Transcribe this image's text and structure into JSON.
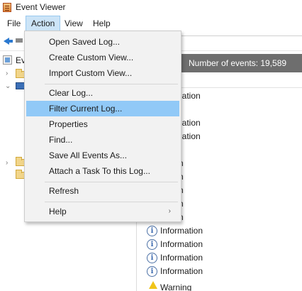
{
  "window": {
    "title": "Event Viewer"
  },
  "menubar": {
    "items": [
      {
        "label": "File"
      },
      {
        "label": "Action"
      },
      {
        "label": "View"
      },
      {
        "label": "Help"
      }
    ]
  },
  "tree": {
    "root_label": "Ev"
  },
  "content": {
    "header_count": "Number of events: 19,589",
    "rows": [
      {
        "level": "nformation"
      },
      {
        "level": "ng"
      },
      {
        "level": "nformation"
      },
      {
        "level": "nformation"
      },
      {
        "level": "ng"
      },
      {
        "level": "nation"
      },
      {
        "level": "nation"
      },
      {
        "level": "nation"
      },
      {
        "level": "nation"
      },
      {
        "level": "nation"
      },
      {
        "level": "Information"
      },
      {
        "level": "Information"
      },
      {
        "level": "Information"
      },
      {
        "level": "Information"
      },
      {
        "level": "Warning"
      }
    ]
  },
  "action_menu": {
    "items": [
      {
        "label": "Open Saved Log..."
      },
      {
        "label": "Create Custom View..."
      },
      {
        "label": "Import Custom View..."
      },
      {
        "label": "Clear Log..."
      },
      {
        "label": "Filter Current Log..."
      },
      {
        "label": "Properties"
      },
      {
        "label": "Find..."
      },
      {
        "label": "Save All Events As..."
      },
      {
        "label": "Attach a Task To this Log..."
      },
      {
        "label": "Refresh"
      },
      {
        "label": "Help",
        "submenu_arrow": "›"
      }
    ]
  }
}
